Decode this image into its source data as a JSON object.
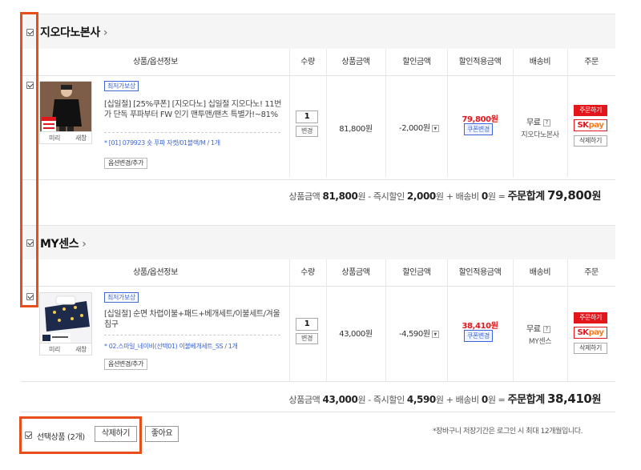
{
  "stores": [
    {
      "name": "지오다노본사",
      "chevron": "›",
      "columns": [
        "상품/옵션정보",
        "수량",
        "상품금액",
        "할인금액",
        "할인적용금액",
        "배송비",
        "주문"
      ],
      "item": {
        "badge": "최저가보상",
        "title": "[십일절] [25%쿠폰] [지오다노] 십일절 지오다노! 11번가 단독 푸파부터 FW 인기 맨투맨/팬츠 특별가!~81%",
        "option": "* [01] 079923 숏 푸파 자켓/01블랙/M / 1개",
        "option_btn": "옵션변경/추가",
        "thumb_btn_left": "미리",
        "thumb_btn_right": "새창",
        "qty": "1",
        "qty_btn": "변경",
        "price": "81,800원",
        "discount": "-2,000원",
        "discount_toggle": "▼",
        "final": "79,800원",
        "coupon_btn": "쿠폰변경",
        "shipping": "무료",
        "shipping_help": "?",
        "shipping_from": "지오다노본사",
        "order_btn": "주문하기",
        "skpay_sk": "SK",
        "skpay_pay": "pay",
        "delete_btn": "삭제하기"
      },
      "summary": {
        "l1": "상품금액",
        "v1": "81,800",
        "u1": "원 - 즉시할인",
        "v2": "2,000",
        "u2": "원 + 배송비",
        "v3": "0",
        "u3": "원 =",
        "total_label": "주문합계",
        "total": "79,800",
        "u4": "원"
      }
    },
    {
      "name": "MY센스",
      "chevron": "›",
      "columns": [
        "상품/옵션정보",
        "수량",
        "상품금액",
        "할인금액",
        "할인적용금액",
        "배송비",
        "주문"
      ],
      "item": {
        "badge": "최저가보상",
        "title": "[십일절] 순면 차렵이불+패드+베개세트/이불세트/겨울침구",
        "option": "* 02.스마일_네이비(선택01) 이불베개세트_SS / 1개",
        "option_btn": "옵션변경/추가",
        "thumb_btn_left": "미리",
        "thumb_btn_right": "새창",
        "qty": "1",
        "qty_btn": "변경",
        "price": "43,000원",
        "discount": "-4,590원",
        "discount_toggle": "▼",
        "final": "38,410원",
        "coupon_btn": "쿠폰변경",
        "shipping": "무료",
        "shipping_help": "?",
        "shipping_from": "MY센스",
        "order_btn": "주문하기",
        "skpay_sk": "SK",
        "skpay_pay": "pay",
        "delete_btn": "삭제하기"
      },
      "summary": {
        "l1": "상품금액",
        "v1": "43,000",
        "u1": "원 - 즉시할인",
        "v2": "4,590",
        "u2": "원 + 배송비",
        "v3": "0",
        "u3": "원 =",
        "total_label": "주문합계",
        "total": "38,410",
        "u4": "원"
      }
    }
  ],
  "footer": {
    "selected_label": "선택상품 (2개)",
    "delete_btn": "삭제하기",
    "like_btn": "좋아요",
    "note": "*장바구니 저장기간은 로그인 시 최대 12개월입니다."
  },
  "colors": {
    "highlight_box": "#e84e1b",
    "sale_red": "#e3161b",
    "link_blue": "#3e66d8"
  }
}
